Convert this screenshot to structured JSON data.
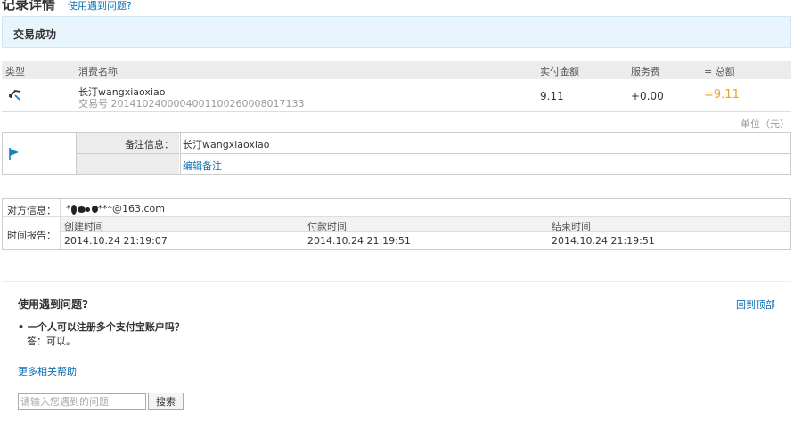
{
  "header": {
    "title": "记录详情",
    "help_link": "使用遇到问题?"
  },
  "status": {
    "text": "交易成功"
  },
  "transaction": {
    "columns": {
      "type": "类型",
      "name": "消费名称",
      "amount": "实付金额",
      "fee": "服务费",
      "total": "= 总额"
    },
    "row": {
      "icon": "transfer-arrow-icon",
      "name": "长汀wangxiaoxiao",
      "trade_no": "交易号 2014102400004001100260008017133",
      "amount": "9.11",
      "fee": "+0.00",
      "total": "=9.11"
    },
    "unit_note": "单位（元）"
  },
  "remark": {
    "icon": "flag-icon",
    "label": "备注信息：",
    "value": "长汀wangxiaoxiao",
    "edit_link": "编辑备注"
  },
  "counterparty": {
    "label": "对方信息：",
    "prefix": "*",
    "masked_suffix": "***@163.com"
  },
  "time_report": {
    "label": "时间报告：",
    "columns": [
      {
        "header": "创建时间",
        "value": "2014.10.24 21:19:07"
      },
      {
        "header": "付款时间",
        "value": "2014.10.24 21:19:51"
      },
      {
        "header": "结束时间",
        "value": "2014.10.24 21:19:51"
      }
    ]
  },
  "help": {
    "title": "使用遇到问题?",
    "back_to_top": "回到顶部",
    "faq": [
      {
        "q": "• 一个人可以注册多个支付宝账户吗？",
        "a": "答：可以。"
      }
    ],
    "more_link": "更多相关帮助",
    "search_placeholder": "请输入您遇到的问题",
    "search_button": "搜索"
  },
  "colors": {
    "accent_link": "#0a6fb3",
    "total_highlight": "#f0a020",
    "banner_bg": "#e9f5fc"
  }
}
